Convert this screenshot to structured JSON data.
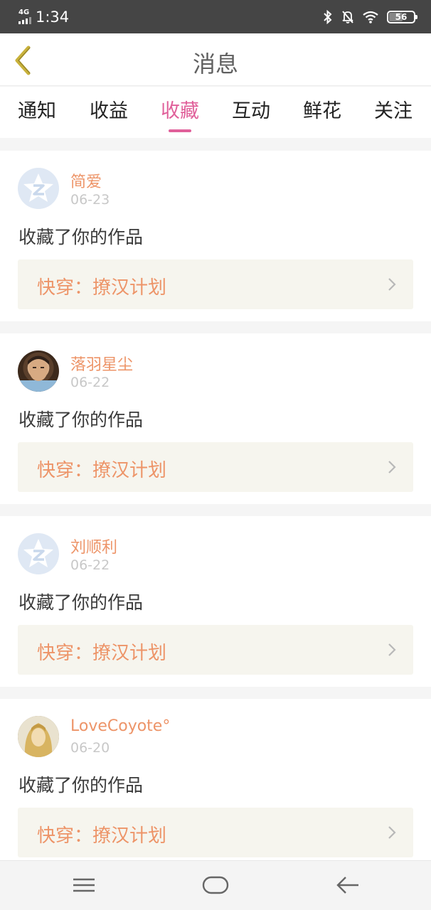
{
  "status_bar": {
    "network": "4G",
    "time": "1:34",
    "battery": "56",
    "battery_level_percent": 56
  },
  "header": {
    "title": "消息",
    "back_icon": "chevron-left-icon"
  },
  "tabs": [
    {
      "label": "通知",
      "active": false
    },
    {
      "label": "收益",
      "active": false
    },
    {
      "label": "收藏",
      "active": true
    },
    {
      "label": "互动",
      "active": false
    },
    {
      "label": "鲜花",
      "active": false
    },
    {
      "label": "关注",
      "active": false
    }
  ],
  "notifications": [
    {
      "username": "简爱",
      "date": "06-23",
      "action": "收藏了你的作品",
      "work": "快穿：撩汉计划",
      "avatar": "default-avatar"
    },
    {
      "username": "落羽星尘",
      "date": "06-22",
      "action": "收藏了你的作品",
      "work": "快穿：撩汉计划",
      "avatar": "photo-avatar"
    },
    {
      "username": "刘顺利",
      "date": "06-22",
      "action": "收藏了你的作品",
      "work": "快穿：撩汉计划",
      "avatar": "default-avatar"
    },
    {
      "username": "LoveCoyote°",
      "date": "06-20",
      "action": "收藏了你的作品",
      "work": "快穿：撩汉计划",
      "avatar": "photo-avatar"
    }
  ],
  "colors": {
    "accent": "#e0609a",
    "username": "#ed9468",
    "status_bar": "#454545",
    "work_box": "#f6f5ee"
  },
  "nav_bar": {
    "menu_icon": "menu-icon",
    "home_icon": "home-icon",
    "back_icon": "back-arrow-icon"
  }
}
